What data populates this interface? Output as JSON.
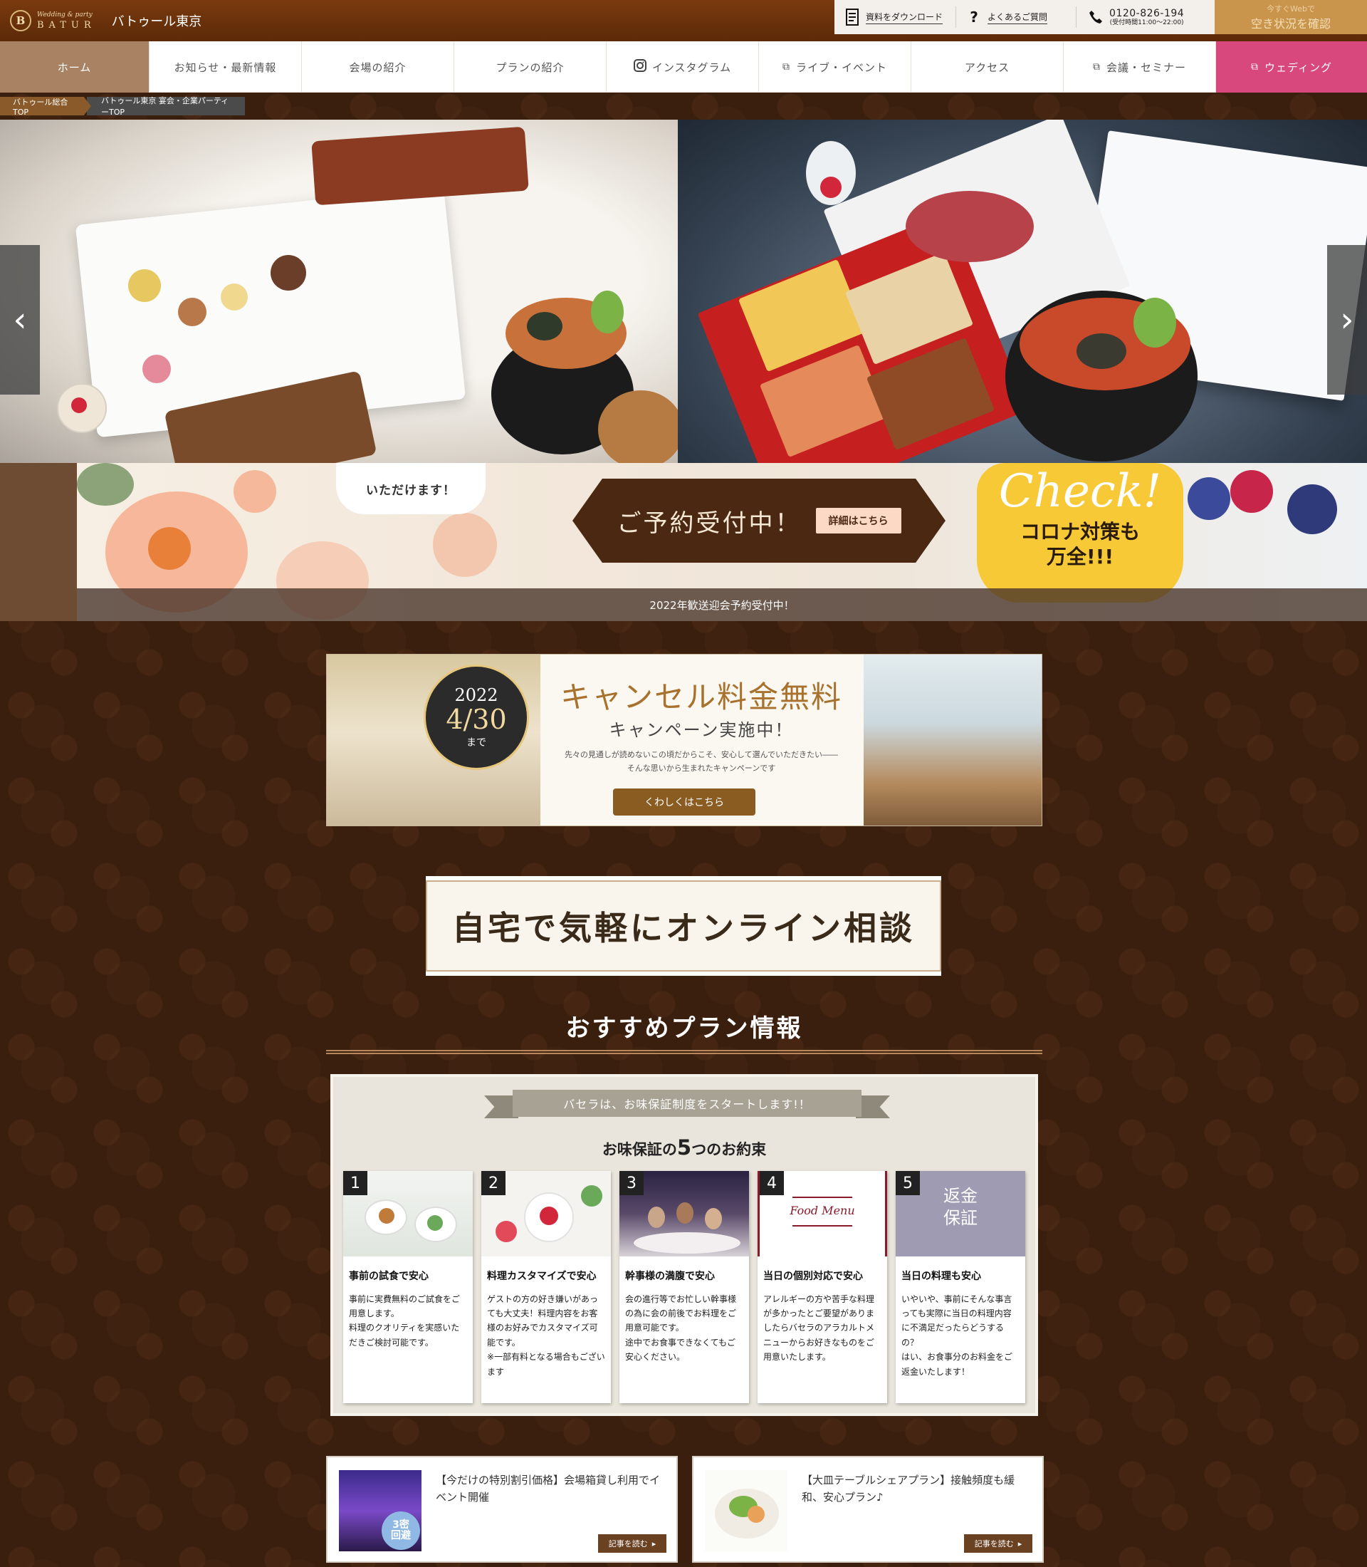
{
  "header": {
    "logo_letter": "B",
    "logo_tagline": "Wedding & party",
    "logo_word": "BATUR",
    "site_name": "バトゥール東京",
    "utility": {
      "download_icon": "document-icon",
      "download_label": "資料をダウンロード",
      "faq_icon": "question-icon",
      "faq_glyph": "?",
      "faq_label": "よくあるご質問",
      "phone_icon": "phone-icon",
      "phone_number": "0120-826-194",
      "phone_hours": "(受付時間11:00～22:00)"
    },
    "availability": {
      "sub": "今すぐWebで",
      "main": "空き状況を確認"
    }
  },
  "nav": {
    "items": [
      {
        "label": "ホーム"
      },
      {
        "label": "お知らせ・最新情報"
      },
      {
        "label": "会場の紹介"
      },
      {
        "label": "プランの紹介"
      },
      {
        "label": "インスタグラム",
        "icon": "instagram-icon"
      },
      {
        "label": "ライブ・イベント",
        "icon": "external-link-icon"
      },
      {
        "label": "アクセス"
      },
      {
        "label": "会議・セミナー",
        "icon": "external-link-icon"
      },
      {
        "label": "ウェディング",
        "icon": "external-link-icon"
      }
    ]
  },
  "breadcrumb": [
    "バトゥール総合TOP",
    "バトゥール東京 宴会・企業パーティーTOP"
  ],
  "hero": {
    "prev_glyph": "‹",
    "next_glyph": "›"
  },
  "banner": {
    "speech": "いただけます！",
    "reserve_title": "ご予約受付中！",
    "reserve_button": "詳細はこちら",
    "check_title": "Check!",
    "check_line1": "コロナ対策も",
    "check_line2": "万全!!!",
    "caption": "2022年歓送迎会予約受付中！"
  },
  "campaign": {
    "year": "2022",
    "date": "4/30",
    "until": "まで",
    "title": "キャンセル料金無料",
    "subtitle": "キャンペーン実施中！",
    "desc1": "先々の見通しが読めないこの頃だからこそ、安心して選んでいただきたい――",
    "desc2": "そんな思いから生まれたキャンペーンです",
    "button": "くわしくはこちら"
  },
  "online": {
    "title": "自宅で気軽にオンライン相談"
  },
  "recommend": {
    "title": "おすすめプラン情報"
  },
  "promise": {
    "ribbon": "バセラは、お味保証制度をスタートします!！",
    "title_pre": "お味保証の",
    "title_num": "5",
    "title_post": "つのお約束",
    "cards": [
      {
        "num": "1",
        "title": "事前の試食で安心",
        "text": "事前に実費無料のご試食をご用意します。\n料理のクオリティを実感いただきご検討可能です。"
      },
      {
        "num": "2",
        "title": "料理カスタマイズで安心",
        "text": "ゲストの方の好き嫌いがあっても大丈夫！料理内容をお客様のお好みでカスタマイズ可能です。\n※一部有料となる場合もございます"
      },
      {
        "num": "3",
        "title": "幹事様の満腹で安心",
        "text": "会の進行等でお忙しい幹事様の為に会の前後でお料理をご用意可能です。\n途中でお食事できなくてもご安心ください。"
      },
      {
        "num": "4",
        "title": "当日の個別対応で安心",
        "text": "アレルギーの方や苦手な料理が多かったとご要望がありましたらバセラのアラカルトメニューからお好きなものをご用意いたします。",
        "image_text": "Food Menu"
      },
      {
        "num": "5",
        "title": "当日の料理も安心",
        "text": "いやいや、事前にそんな事言っても実際に当日の料理内容に不満足だったらどうするの？\nはい、お食事分のお料金をご返金いたします！",
        "image_text_1": "返金",
        "image_text_2": "保証"
      }
    ]
  },
  "articles": [
    {
      "text": "【今だけの特別割引価格】会場箱貸し利用でイベント開催",
      "button": "記事を読む",
      "badge": "3密\n回避"
    },
    {
      "text": "【大皿テーブルシェアプラン】接触頻度も緩和、安心プラン♪",
      "button": "記事を読む"
    }
  ],
  "colors": {
    "header_brown": "#6b3210",
    "nav_home": "#a88263",
    "nav_wedding": "#d8487c",
    "body_bg": "#3a1f0e",
    "accent_gold": "#c9954c"
  }
}
